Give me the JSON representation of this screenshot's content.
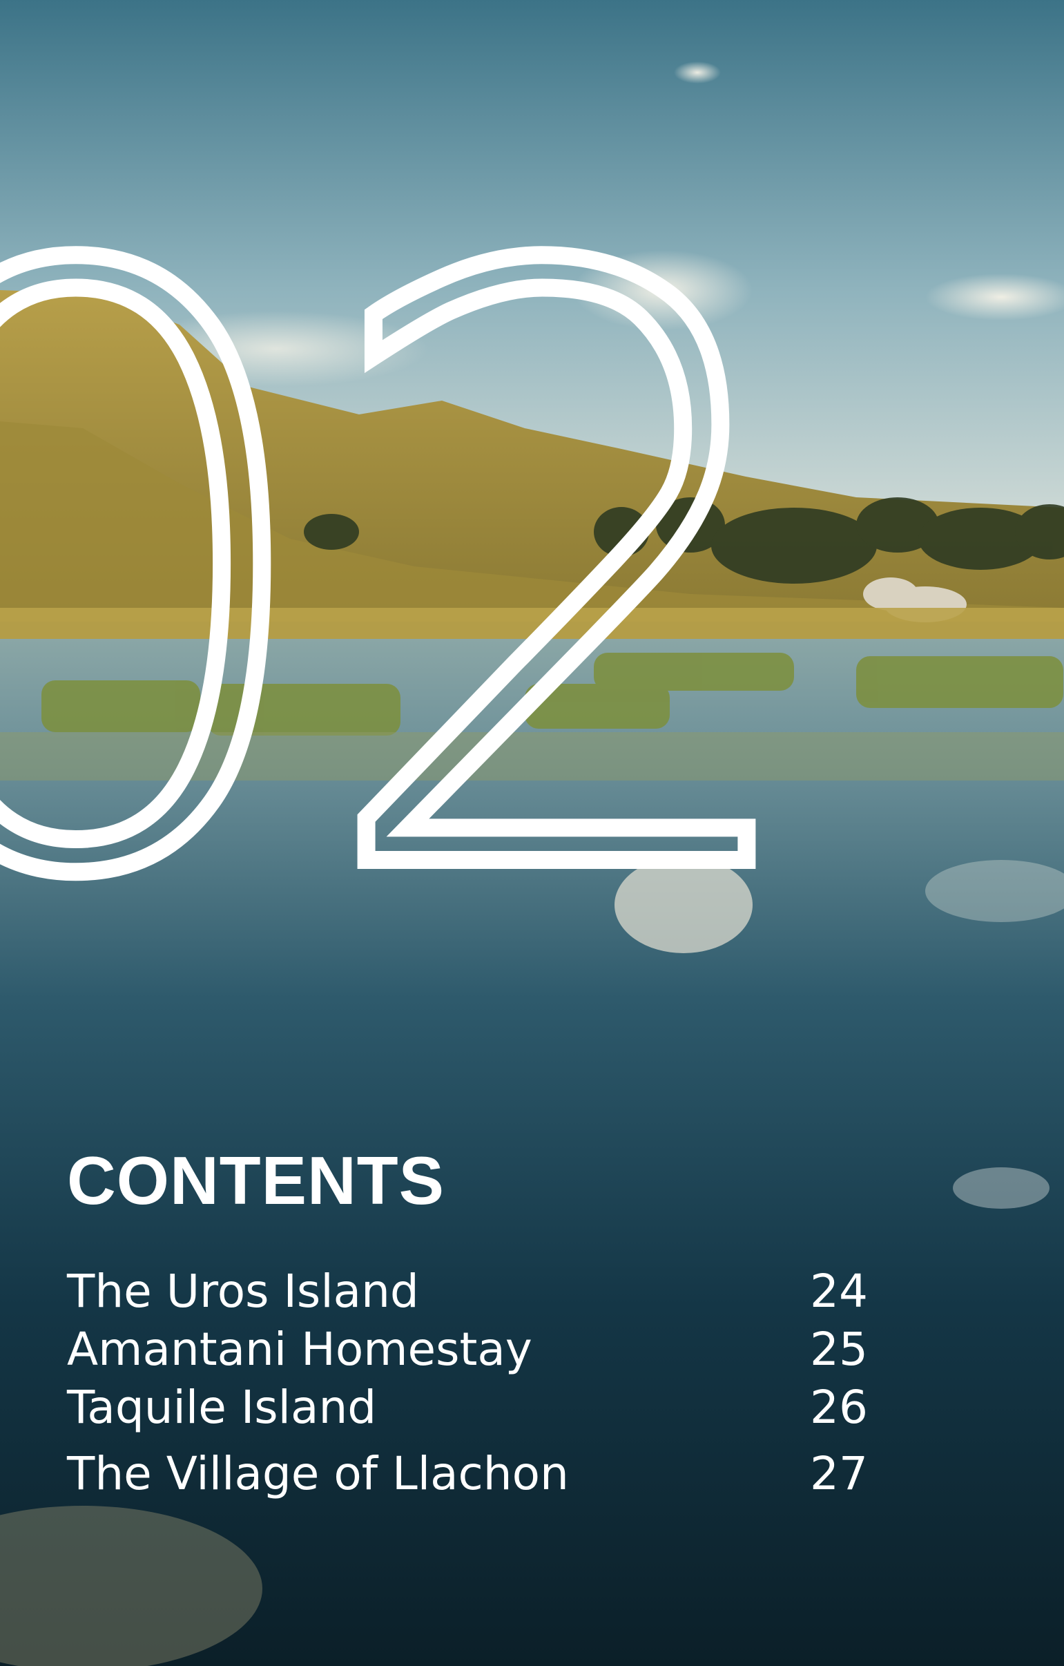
{
  "chapter": {
    "number": "02"
  },
  "contents": {
    "title": "CONTENTS",
    "items": [
      {
        "title": "The Uros Island",
        "page": "24"
      },
      {
        "title": "Amantani Homestay",
        "page": "25"
      },
      {
        "title": "Taquile Island",
        "page": "26"
      },
      {
        "title": "The Village of Llachon",
        "page": "27"
      }
    ]
  },
  "colors": {
    "text": "#ffffff",
    "sky_top": "#3f7a8c",
    "hills": "#b49a3c",
    "water_deep": "#0f3040"
  },
  "photo": {
    "subject": "lake-landscape-photo"
  }
}
